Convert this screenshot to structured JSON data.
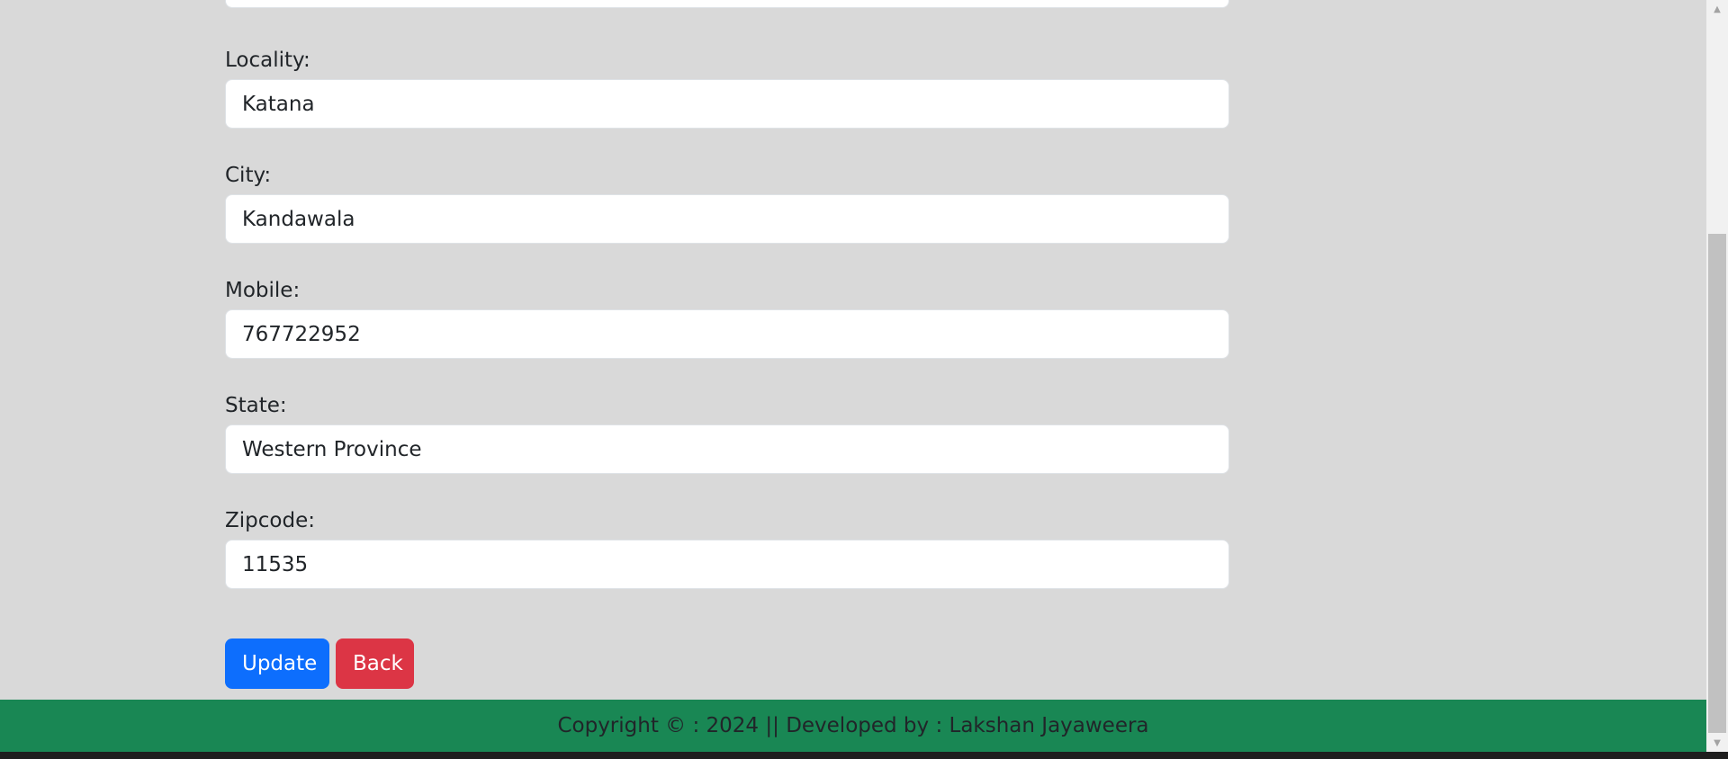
{
  "form": {
    "fields": [
      {
        "label": "Locality:",
        "value": "Katana"
      },
      {
        "label": "City:",
        "value": "Kandawala"
      },
      {
        "label": "Mobile:",
        "value": "767722952"
      },
      {
        "label": "State:",
        "value": "Western Province"
      },
      {
        "label": "Zipcode:",
        "value": "11535"
      }
    ],
    "update_label": "Update",
    "back_label": "Back"
  },
  "footer": {
    "text": "Copyright © : 2024 || Developed by : Lakshan Jayaweera"
  },
  "colors": {
    "background": "#d9d9d9",
    "primary": "#0d6efd",
    "danger": "#dc3545",
    "footer": "#198754"
  },
  "icons": {
    "scroll_up": "triangle-up-icon",
    "scroll_down": "triangle-down-icon"
  }
}
